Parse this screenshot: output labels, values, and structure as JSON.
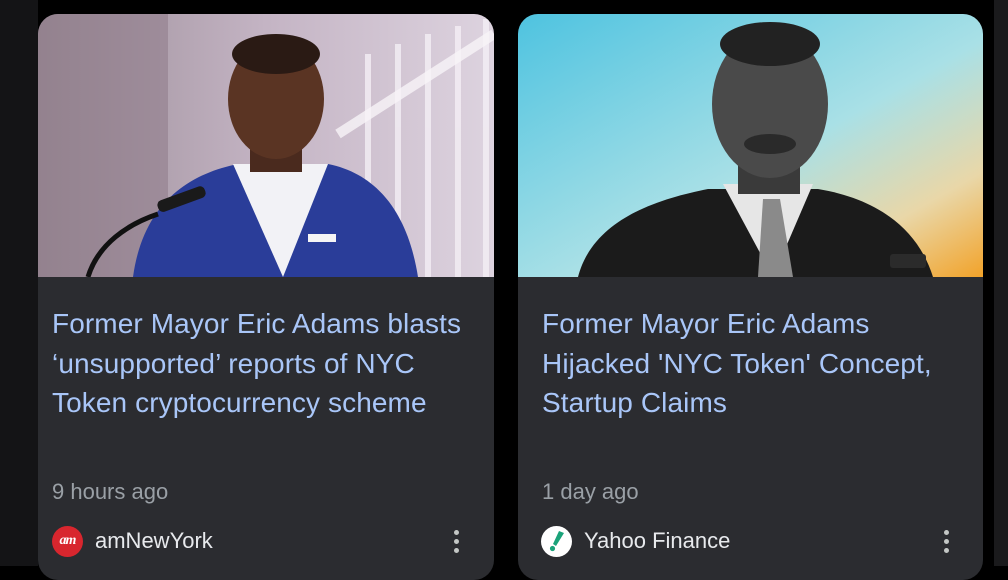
{
  "articles": [
    {
      "headline": "Former Mayor Eric Adams blasts ‘unsupported’ reports of NYC Token cryptocurrency scheme",
      "time": "9 hours ago",
      "source": "amNewYork",
      "source_logo_text": "am",
      "source_logo_color": "#d8262e",
      "image_description": "man in blue suit speaking at microphone"
    },
    {
      "headline": "Former Mayor Eric Adams Hijacked 'NYC Token' Concept, Startup Claims",
      "time": "1 day ago",
      "source": "Yahoo Finance",
      "source_logo_color": "#ffffff",
      "image_description": "black and white photo of man on blue-orange gradient"
    }
  ],
  "colors": {
    "card_bg": "#2b2c30",
    "headline": "#a9c6f8",
    "meta": "#9aa0a6",
    "source": "#e8eaed"
  }
}
